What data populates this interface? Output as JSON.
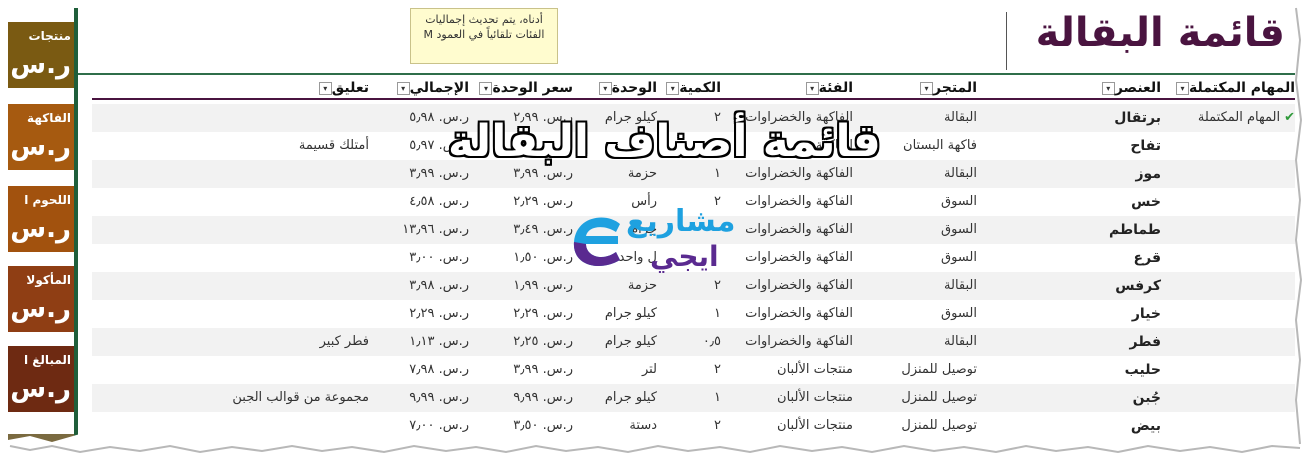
{
  "title": "قائمة البقالة",
  "note_text": "أدناه، يتم تحديث إجماليات الفئات تلقائياً في العمود M",
  "overlay_title": "قائمة أصناف البقالة",
  "logo": {
    "line1": "مشاريع",
    "line2": "ايجي"
  },
  "categories": [
    {
      "name": "منتجات",
      "total": "ر.س.",
      "color": "#7a5a12"
    },
    {
      "name": "الفاكهة",
      "total": "ر.س.",
      "color": "#a65a10"
    },
    {
      "name": "اللحوم ا",
      "total": "ر.س.",
      "color": "#a2520e"
    },
    {
      "name": "المأكولا",
      "total": "ر.س.",
      "color": "#8f3e14"
    },
    {
      "name": "المبالغ ا",
      "total": "ر.س.",
      "color": "#6e2a12"
    }
  ],
  "headers": {
    "done": "المهام المكتملة",
    "item": "العنصر",
    "store": "المتجر",
    "category": "الفئة",
    "qty": "الكمية",
    "unit": "الوحدة",
    "price": "سعر الوحدة",
    "total": "الإجمالي",
    "comment": "تعليق",
    "filter_icon": "▾"
  },
  "rows": [
    {
      "done": "المهام المكتملة",
      "check": "✔",
      "item": "برتقال",
      "store": "البقالة",
      "category": "الفاكهة والخضراوات",
      "qty": "٢",
      "unit": "كيلو جرام",
      "price": "ر.س. ٢٫٩٩",
      "total": "ر.س. ٥٫٩٨",
      "comment": ""
    },
    {
      "done": "",
      "check": "",
      "item": "تفاح",
      "store": "فاكهة البستان",
      "category": "الفاكهة",
      "qty": "٣",
      "unit": "",
      "price": "",
      "total": "ر.س. ٥٫٩٧",
      "comment": "أمتلك قسيمة"
    },
    {
      "done": "",
      "check": "",
      "item": "موز",
      "store": "البقالة",
      "category": "الفاكهة والخضراوات",
      "qty": "١",
      "unit": "حزمة",
      "price": "ر.س. ٣٫٩٩",
      "total": "ر.س. ٣٫٩٩",
      "comment": ""
    },
    {
      "done": "",
      "check": "",
      "item": "خس",
      "store": "السوق",
      "category": "الفاكهة والخضراوات",
      "qty": "٢",
      "unit": "رأس",
      "price": "ر.س. ٢٫٢٩",
      "total": "ر.س. ٤٫٥٨",
      "comment": ""
    },
    {
      "done": "",
      "check": "",
      "item": "طماطم",
      "store": "السوق",
      "category": "الفاكهة والخضراوات",
      "qty": "",
      "unit": "جرام",
      "price": "ر.س. ٣٫٤٩",
      "total": "ر.س. ١٣٫٩٦",
      "comment": ""
    },
    {
      "done": "",
      "check": "",
      "item": "قرع",
      "store": "السوق",
      "category": "الفاكهة والخضراوات",
      "qty": "",
      "unit": "ل واحدة",
      "price": "ر.س. ١٫٥٠",
      "total": "ر.س. ٣٫٠٠",
      "comment": ""
    },
    {
      "done": "",
      "check": "",
      "item": "كرفس",
      "store": "البقالة",
      "category": "الفاكهة والخضراوات",
      "qty": "٢",
      "unit": "حزمة",
      "price": "ر.س. ١٫٩٩",
      "total": "ر.س. ٣٫٩٨",
      "comment": ""
    },
    {
      "done": "",
      "check": "",
      "item": "خيار",
      "store": "السوق",
      "category": "الفاكهة والخضراوات",
      "qty": "١",
      "unit": "كيلو جرام",
      "price": "ر.س. ٢٫٢٩",
      "total": "ر.س. ٢٫٢٩",
      "comment": ""
    },
    {
      "done": "",
      "check": "",
      "item": "فطر",
      "store": "البقالة",
      "category": "الفاكهة والخضراوات",
      "qty": "٠٫٥",
      "unit": "كيلو جرام",
      "price": "ر.س. ٢٫٢٥",
      "total": "ر.س. ١٫١٣",
      "comment": "فطر كبير"
    },
    {
      "done": "",
      "check": "",
      "item": "حليب",
      "store": "توصيل للمنزل",
      "category": "منتجات الألبان",
      "qty": "٢",
      "unit": "لتر",
      "price": "ر.س. ٣٫٩٩",
      "total": "ر.س. ٧٫٩٨",
      "comment": ""
    },
    {
      "done": "",
      "check": "",
      "item": "جُبن",
      "store": "توصيل للمنزل",
      "category": "منتجات الألبان",
      "qty": "١",
      "unit": "كيلو جرام",
      "price": "ر.س. ٩٫٩٩",
      "total": "ر.س. ٩٫٩٩",
      "comment": "مجموعة من قوالب الجبن"
    },
    {
      "done": "",
      "check": "",
      "item": "بيض",
      "store": "توصيل للمنزل",
      "category": "منتجات الألبان",
      "qty": "٢",
      "unit": "دستة",
      "price": "ر.س. ٣٫٥٠",
      "total": "ر.س. ٧٫٠٠",
      "comment": ""
    }
  ]
}
